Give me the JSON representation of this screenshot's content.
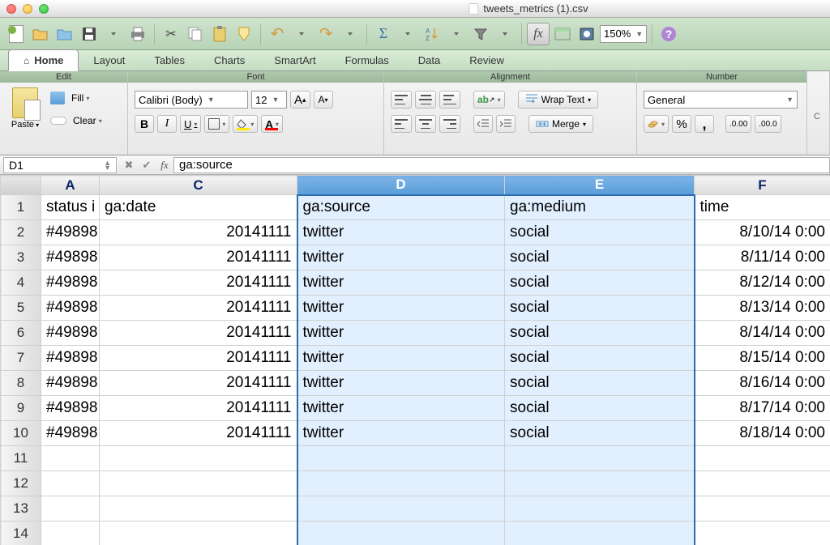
{
  "window": {
    "title": "tweets_metrics (1).csv"
  },
  "toolbar": {
    "zoom": "150%"
  },
  "tabs": {
    "home": "Home",
    "layout": "Layout",
    "tables": "Tables",
    "charts": "Charts",
    "smartart": "SmartArt",
    "formulas": "Formulas",
    "data": "Data",
    "review": "Review"
  },
  "ribbon": {
    "edit": {
      "title": "Edit",
      "paste": "Paste",
      "fill": "Fill",
      "clear": "Clear"
    },
    "font": {
      "title": "Font",
      "name": "Calibri (Body)",
      "size": "12"
    },
    "alignment": {
      "title": "Alignment",
      "wrap": "Wrap Text",
      "merge": "Merge"
    },
    "number": {
      "title": "Number",
      "format": "General"
    }
  },
  "formulabar": {
    "cell": "D1",
    "value": "ga:source"
  },
  "columns": [
    "A",
    "C",
    "D",
    "E",
    "F"
  ],
  "rows_visible": [
    "1",
    "2",
    "3",
    "4",
    "5",
    "6",
    "7",
    "8",
    "9",
    "10",
    "11",
    "12",
    "13",
    "14"
  ],
  "headers": {
    "A": "status i",
    "C": "ga:date",
    "D": "ga:source",
    "E": "ga:medium",
    "F": "time"
  },
  "data_rows": [
    {
      "A": "#49898",
      "C": "20141111",
      "D": "twitter",
      "E": "social",
      "F": "8/10/14 0:00"
    },
    {
      "A": "#49898",
      "C": "20141111",
      "D": "twitter",
      "E": "social",
      "F": "8/11/14 0:00"
    },
    {
      "A": "#49898",
      "C": "20141111",
      "D": "twitter",
      "E": "social",
      "F": "8/12/14 0:00"
    },
    {
      "A": "#49898",
      "C": "20141111",
      "D": "twitter",
      "E": "social",
      "F": "8/13/14 0:00"
    },
    {
      "A": "#49898",
      "C": "20141111",
      "D": "twitter",
      "E": "social",
      "F": "8/14/14 0:00"
    },
    {
      "A": "#49898",
      "C": "20141111",
      "D": "twitter",
      "E": "social",
      "F": "8/15/14 0:00"
    },
    {
      "A": "#49898",
      "C": "20141111",
      "D": "twitter",
      "E": "social",
      "F": "8/16/14 0:00"
    },
    {
      "A": "#49898",
      "C": "20141111",
      "D": "twitter",
      "E": "social",
      "F": "8/17/14 0:00"
    },
    {
      "A": "#49898",
      "C": "20141111",
      "D": "twitter",
      "E": "social",
      "F": "8/18/14 0:00"
    }
  ]
}
